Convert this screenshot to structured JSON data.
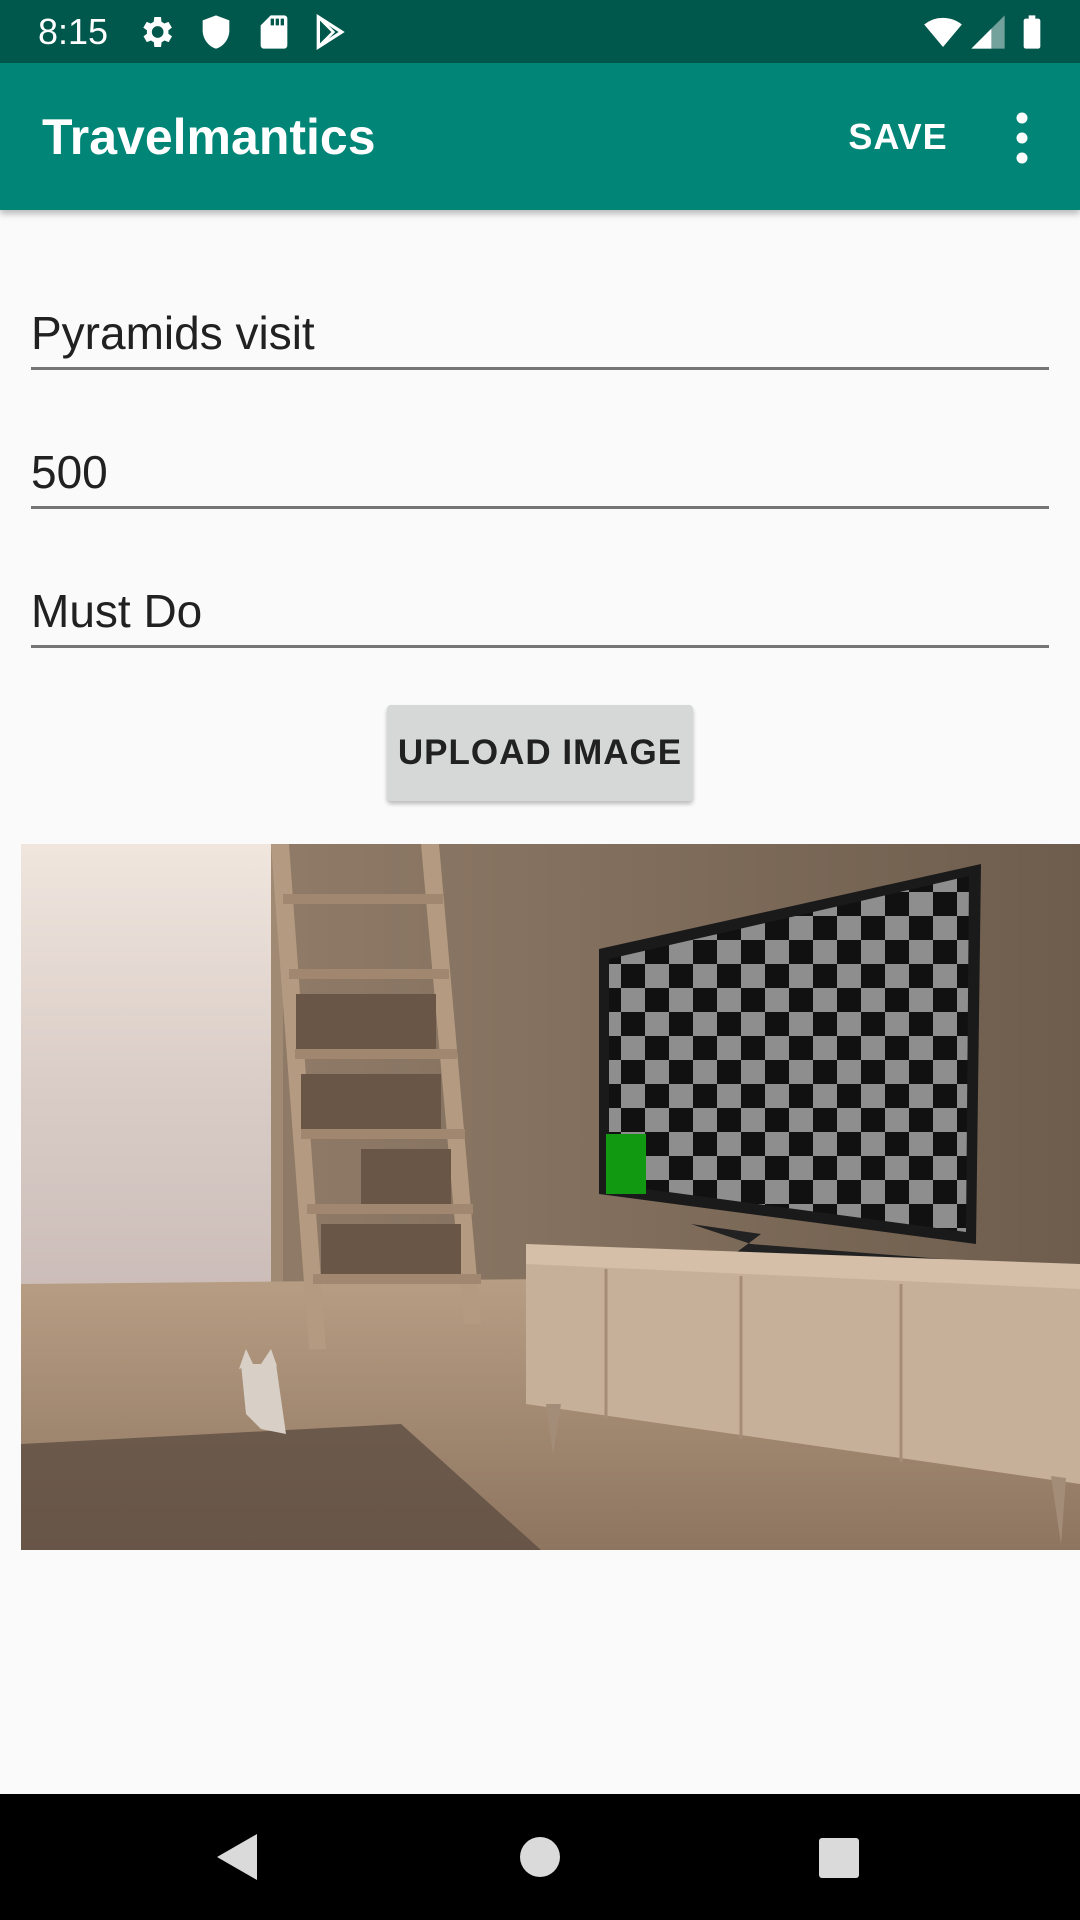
{
  "status_bar": {
    "time": "8:15",
    "left_icons": [
      "settings-icon",
      "shield-icon",
      "sd-card-icon",
      "play-store-icon"
    ],
    "right_icons": [
      "wifi-icon",
      "signal-icon",
      "battery-icon"
    ]
  },
  "app_bar": {
    "title": "Travelmantics",
    "save_label": "SAVE",
    "overflow_icon": "more-vert-icon"
  },
  "form": {
    "title_value": "Pyramids visit",
    "price_value": "500",
    "description_value": "Must Do",
    "upload_label": "UPLOAD IMAGE"
  },
  "nav_bar": {
    "icons": [
      "back-icon",
      "home-icon",
      "recents-icon"
    ]
  },
  "colors": {
    "status_bar": "#00574b",
    "app_bar": "#008577",
    "background": "#fafafa"
  }
}
